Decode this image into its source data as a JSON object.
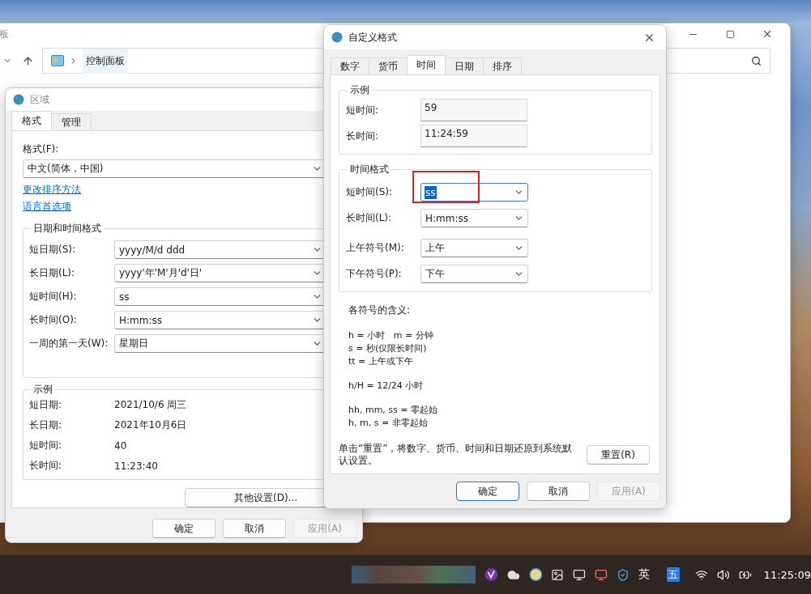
{
  "explorer": {
    "title": "板",
    "breadcrumb": "控制面板"
  },
  "region_window": {
    "title": "区域",
    "tabs": [
      {
        "label": "格式",
        "selected": true
      },
      {
        "label": "管理",
        "selected": false
      }
    ],
    "format_label": "格式(F):",
    "format_value": "中文(简体，中国)",
    "links": [
      "更改排序方法",
      "语言首选项"
    ],
    "datetime_group": {
      "title": "日期和时间格式",
      "rows": [
        {
          "label": "短日期(S):",
          "value": "yyyy/M/d ddd"
        },
        {
          "label": "长日期(L):",
          "value": "yyyy'年'M'月'd'日'"
        },
        {
          "label": "短时间(H):",
          "value": "ss"
        },
        {
          "label": "长时间(O):",
          "value": "H:mm:ss"
        },
        {
          "label": "一周的第一天(W):",
          "value": "星期日"
        }
      ]
    },
    "example_group": {
      "title": "示例",
      "rows": [
        {
          "label": "短日期:",
          "value": "2021/10/6 周三"
        },
        {
          "label": "长日期:",
          "value": "2021年10月6日"
        },
        {
          "label": "短时间:",
          "value": "40"
        },
        {
          "label": "长时间:",
          "value": "11:23:40"
        }
      ]
    },
    "more_button": "其他设置(D)...",
    "buttons": [
      {
        "label": "确定",
        "disabled": false
      },
      {
        "label": "取消",
        "disabled": false
      },
      {
        "label": "应用(A)",
        "disabled": true
      }
    ]
  },
  "custom_dialog": {
    "title": "自定义格式",
    "tabs": [
      {
        "label": "数字",
        "selected": false
      },
      {
        "label": "货币",
        "selected": false
      },
      {
        "label": "时间",
        "selected": true
      },
      {
        "label": "日期",
        "selected": false
      },
      {
        "label": "排序",
        "selected": false
      }
    ],
    "example_group": {
      "title": "示例",
      "rows": [
        {
          "label": "短时间:",
          "value": "59"
        },
        {
          "label": "长时间:",
          "value": "11:24:59"
        }
      ]
    },
    "format_group": {
      "title": "时间格式",
      "rows": [
        {
          "label": "短时间(S):",
          "value": "ss",
          "focused": true,
          "annotated": true
        },
        {
          "label": "长时间(L):",
          "value": "H:mm:ss",
          "focused": false,
          "annotated": false
        },
        {
          "label": "上午符号(M):",
          "value": "上午",
          "focused": false,
          "annotated": false
        },
        {
          "label": "下午符号(P):",
          "value": "下午",
          "focused": false,
          "annotated": false
        }
      ]
    },
    "legend": {
      "title": "各符号的含义:",
      "paragraphs": [
        [
          "h = 小时   m = 分钟",
          "s = 秒(仅限长时间)",
          "tt = 上午或下午"
        ],
        [
          "h/H = 12/24 小时"
        ],
        [
          "hh, mm, ss = 零起始",
          "h, m, s = 非零起始"
        ]
      ]
    },
    "reset_note": "单击“重置”，将数字、货币、时间和日期还原到系统默认设置。",
    "reset_button": "重置(R)",
    "buttons": [
      {
        "label": "确定",
        "disabled": false,
        "default": true
      },
      {
        "label": "取消",
        "disabled": false,
        "default": false
      },
      {
        "label": "应用(A)",
        "disabled": true,
        "default": false
      }
    ]
  },
  "taskbar": {
    "language": "英",
    "ime": "五",
    "clock": "11:25:09"
  }
}
